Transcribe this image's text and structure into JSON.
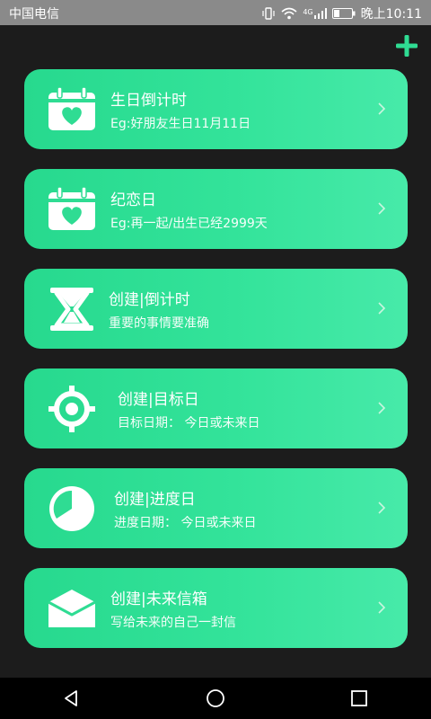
{
  "status_bar": {
    "carrier": "中国电信",
    "network": "4G",
    "time": "晚上10:11"
  },
  "colors": {
    "accent": "#2fdc93",
    "background": "#1c1c1c"
  },
  "cards": [
    {
      "title": "生日倒计时",
      "subtitle": "Eg:好朋友生日11月11日",
      "icon": "calendar-heart-icon"
    },
    {
      "title": "纪恋日",
      "subtitle": "Eg:再一起/出生已经2999天",
      "icon": "calendar-heart-icon"
    },
    {
      "title": "创建|倒计时",
      "subtitle": "重要的事情要准确",
      "icon": "hourglass-icon"
    },
    {
      "title": "创建|目标日",
      "subtitle": "目标日期：  今日或未来日",
      "icon": "target-icon"
    },
    {
      "title": "创建|进度日",
      "subtitle": "进度日期：  今日或未来日",
      "icon": "pie-progress-icon"
    },
    {
      "title": "创建|未来信箱",
      "subtitle": "写给未来的自己一封信",
      "icon": "envelope-icon"
    }
  ]
}
